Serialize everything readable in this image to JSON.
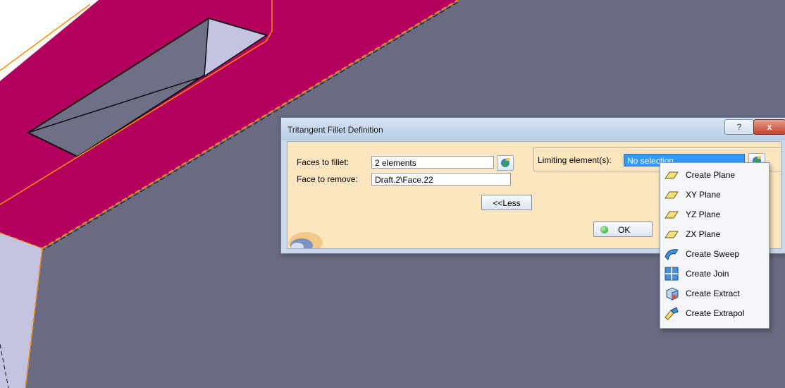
{
  "dialog": {
    "title": "Tritangent Fillet Definition",
    "help_label": "?",
    "close_label": "x",
    "faces_to_fillet_label": "Faces to fillet:",
    "faces_to_fillet_value": "2 elements",
    "face_to_remove_label": "Face to remove:",
    "face_to_remove_value": "Draft.2\\Face.22",
    "limiting_elements_label": "Limiting element(s):",
    "limiting_elements_value": "No selection",
    "less_button_label": "<<Less",
    "ok_button_label": "OK"
  },
  "context_menu": {
    "items": [
      {
        "label": "Create Plane",
        "icon": "plane-icon"
      },
      {
        "label": "XY Plane",
        "icon": "plane-icon"
      },
      {
        "label": "YZ Plane",
        "icon": "plane-icon"
      },
      {
        "label": "ZX Plane",
        "icon": "plane-icon"
      },
      {
        "label": "Create Sweep",
        "icon": "sweep-icon"
      },
      {
        "label": "Create Join",
        "icon": "join-icon"
      },
      {
        "label": "Create Extract",
        "icon": "extract-icon"
      },
      {
        "label": "Create Extrapol",
        "icon": "extrapol-icon"
      }
    ]
  },
  "colors": {
    "part_top_face": "#b3005e",
    "part_side_face": "#6a6a80",
    "part_light_face": "#c4c4e2",
    "edge_highlight": "#ff8c00",
    "dialog_body": "#fde5bf",
    "selection_blue": "#3399ff"
  }
}
